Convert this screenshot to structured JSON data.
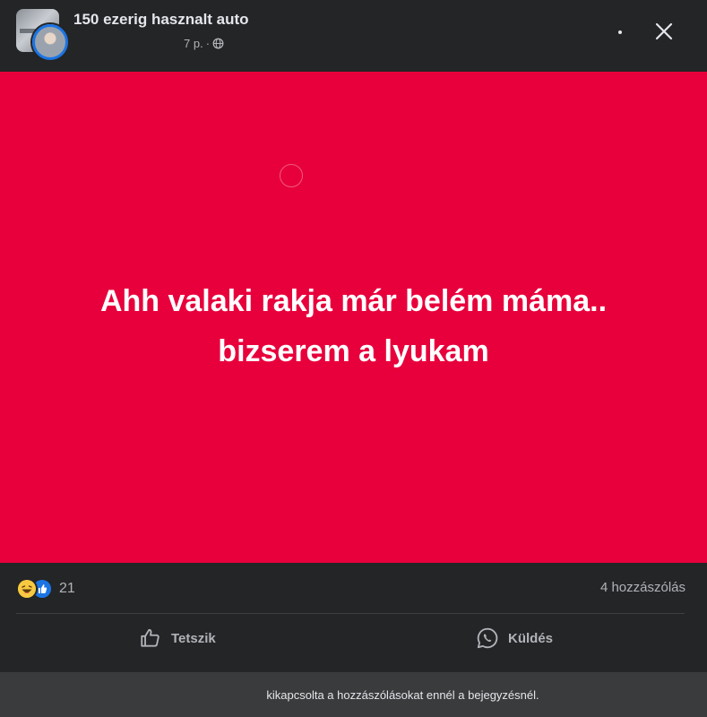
{
  "header": {
    "group_name": "150 ezerig hasznalt auto",
    "timestamp": "7 p.",
    "separator": "·",
    "privacy_icon": "globe-icon",
    "more_icon": "more-icon",
    "close_icon": "close-icon"
  },
  "post": {
    "background_color": "#e8003c",
    "text_lines": [
      "Ahh valaki rakja már belém máma..",
      "bizserem a lyukam"
    ]
  },
  "reactions": {
    "icons": [
      "haha-reaction-icon",
      "like-reaction-icon"
    ],
    "count": "21"
  },
  "comments": {
    "count_label": "4 hozzászólás"
  },
  "actions": {
    "like_label": "Tetszik",
    "send_label": "Küldés"
  },
  "footer": {
    "notice": "kikapcsolta a hozzászólásokat ennél a bejegyzésnél."
  }
}
